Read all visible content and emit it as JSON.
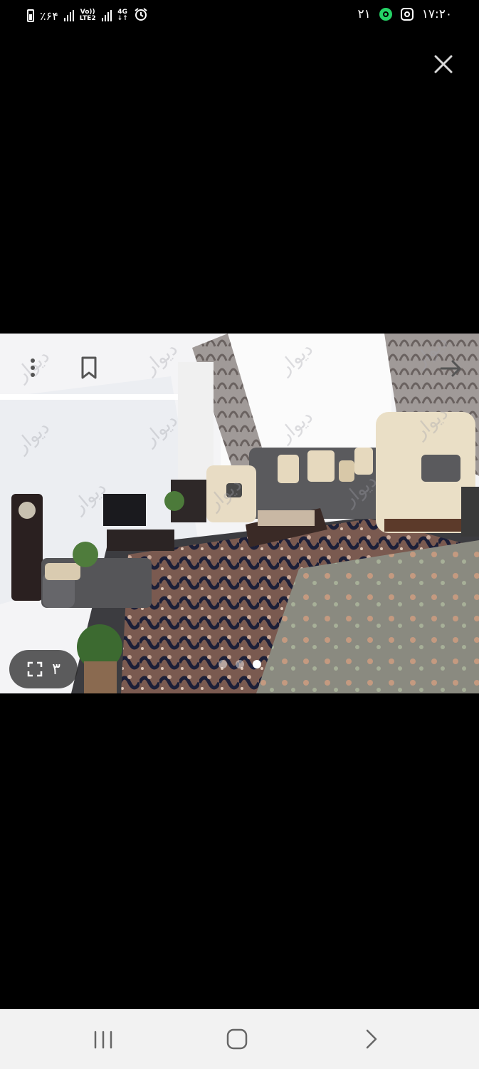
{
  "status_bar": {
    "battery_text": "٪۶۴",
    "volte_label": "Vo))",
    "lte_label": "LTE2",
    "network_label": "4G",
    "notification_count": "۲۱",
    "time": "۱۷:۲۰"
  },
  "viewer": {
    "image_counter": "۳",
    "watermark_text": "دیوار",
    "total_images": 3,
    "active_image_index": 3
  },
  "colors": {
    "background": "#000000",
    "navbar": "#f2f2f2",
    "whatsapp": "#25d366"
  },
  "icons": [
    "close-icon",
    "more-vertical-icon",
    "bookmark-icon",
    "arrow-right-icon",
    "fullscreen-icon",
    "recent-apps-icon",
    "home-icon",
    "back-icon"
  ]
}
